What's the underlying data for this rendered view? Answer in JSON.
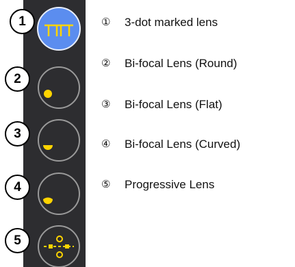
{
  "colors": {
    "panel": "#2d2d30",
    "active_lens": "#5b8def",
    "marker": "#ffd400",
    "lens_ring": "#9a9a9a"
  },
  "badges": [
    "1",
    "2",
    "3",
    "4",
    "5"
  ],
  "legend": [
    {
      "num": "①",
      "label": "3-dot marked lens"
    },
    {
      "num": "②",
      "label": "Bi-focal Lens (Round)"
    },
    {
      "num": "③",
      "label": "Bi-focal Lens (Flat)"
    },
    {
      "num": "④",
      "label": "Bi-focal Lens (Curved)"
    },
    {
      "num": "⑤",
      "label": "Progressive Lens"
    }
  ],
  "lenses": [
    {
      "icon": "three-dot-lens-icon",
      "selected": true
    },
    {
      "icon": "bifocal-round-icon",
      "selected": false
    },
    {
      "icon": "bifocal-flat-icon",
      "selected": false
    },
    {
      "icon": "bifocal-curved-icon",
      "selected": false
    },
    {
      "icon": "progressive-lens-icon",
      "selected": false
    }
  ]
}
